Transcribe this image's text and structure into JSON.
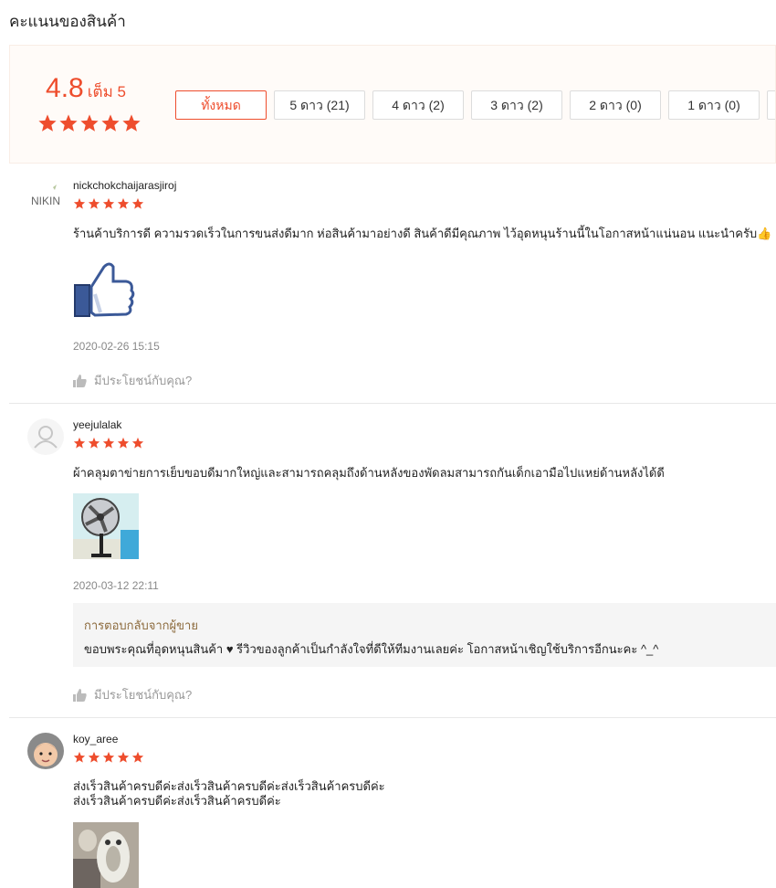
{
  "page": {
    "title": "คะแนนของสินค้า"
  },
  "summary": {
    "score": "4.8",
    "score_of": "เต็ม 5",
    "stars": 5,
    "accent_color": "#ee4d2d",
    "filters": [
      {
        "label": "ทั้งหมด",
        "active": true
      },
      {
        "label": "5 ดาว (21)",
        "active": false
      },
      {
        "label": "4 ดาว (2)",
        "active": false
      },
      {
        "label": "3 ดาว (2)",
        "active": false
      },
      {
        "label": "2 ดาว (0)",
        "active": false
      },
      {
        "label": "1 ดาว (0)",
        "active": false
      }
    ]
  },
  "reviews": [
    {
      "username": "nickchokchaijarasjiroj",
      "avatar_text": "NIKIN",
      "avatar_icon": "logo-avatar",
      "rating": 5,
      "comment": "ร้านค้าบริการดี ความรวดเร็วในการขนส่งดีมาก ห่อสินค้ามาอย่างดี สินค้าดีมีคุณภาพ ไว้อุดหนุนร้านนี้ในโอกาสหน้าแน่นอน แนะนำครับ👍",
      "image_icon": "thumbs-up-image",
      "date": "2020-02-26 15:15",
      "helpful_label": "มีประโยชน์กับคุณ?"
    },
    {
      "username": "yeejulalak",
      "avatar_icon": "default-user-icon",
      "rating": 5,
      "comment": "ผ้าคลุมตาข่ายการเย็บขอบดีมากใหญ่และสามารถคลุมถึงด้านหลังของพัดลมสามารถกันเด็กเอามือไปแหย่ด้านหลังได้ดี",
      "image_icon": "fan-photo",
      "date": "2020-03-12 22:11",
      "seller_reply": {
        "label": "การตอบกลับจากผู้ขาย",
        "text": "ขอบพระคุณที่อุดหนุนสินค้า ♥ รีวิวของลูกค้าเป็นกำลังใจที่ดีให้ทีมงานเลยค่ะ โอกาสหน้าเชิญใช้บริการอีกนะคะ ^_^"
      },
      "helpful_label": "มีประโยชน์กับคุณ?"
    },
    {
      "username": "koy_aree",
      "avatar_icon": "baby-photo-avatar",
      "rating": 5,
      "comment": "ส่งเร็วสินค้าครบดีค่ะส่งเร็วสินค้าครบดีค่ะส่งเร็วสินค้าครบดีค่ะ\nส่งเร็วสินค้าครบดีค่ะส่งเร็วสินค้าครบดีค่ะ",
      "image_icon": "pillow-photo"
    }
  ]
}
